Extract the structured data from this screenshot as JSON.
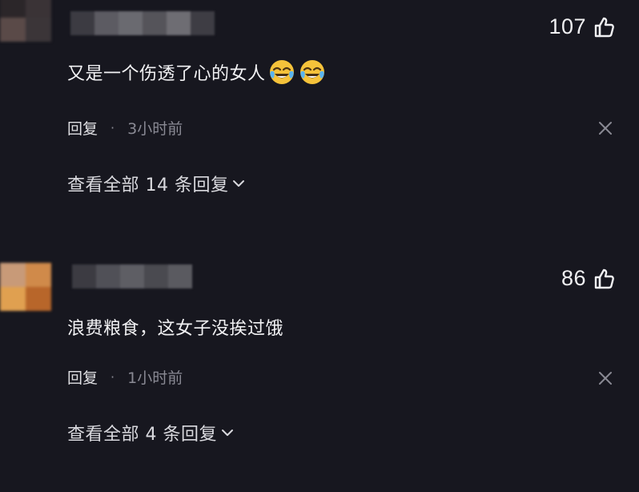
{
  "comments": [
    {
      "text": "又是一个伤透了心的女人",
      "emoji": [
        "crying-laughing-emoji",
        "crying-laughing-emoji"
      ],
      "likes": "107",
      "reply_label": "回复",
      "separator": "·",
      "time": "3小时前",
      "view_replies": "查看全部 14 条回复"
    },
    {
      "text": "浪费粮食，这女子没挨过饿",
      "likes": "86",
      "reply_label": "回复",
      "separator": "·",
      "time": "1小时前",
      "view_replies": "查看全部 4 条回复"
    }
  ],
  "icons": {
    "like": "thumbs-up-icon",
    "dismiss": "close-icon",
    "expand": "chevron-down-icon"
  },
  "colors": {
    "background": "#17171f",
    "text_primary": "#f2f2f4",
    "text_secondary": "#8a8a94"
  }
}
